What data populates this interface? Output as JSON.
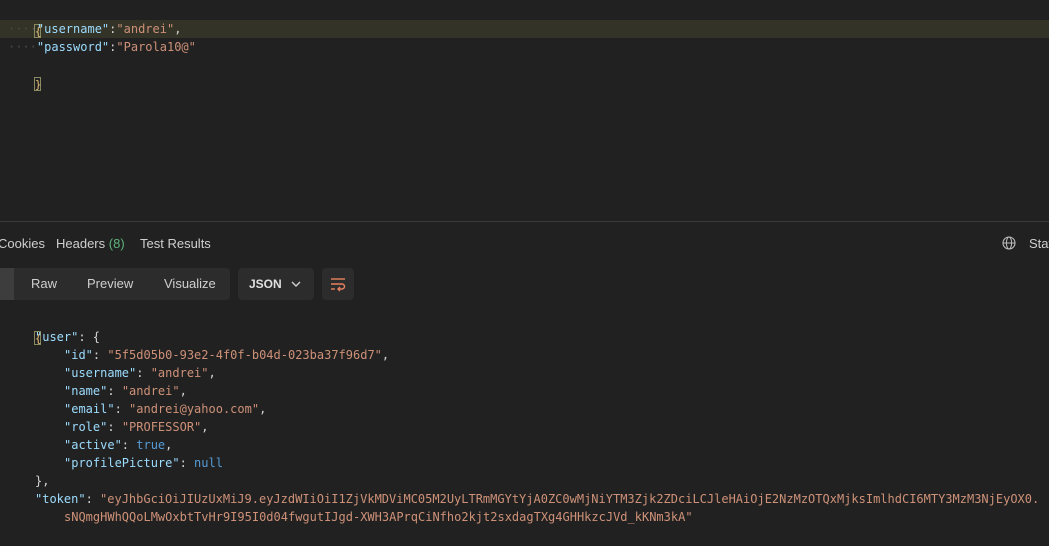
{
  "request_body": {
    "lines": [
      {
        "key": "\"username\"",
        "value": "\"andrei\"",
        "trail": ","
      },
      {
        "key": "\"password\"",
        "value": "\"Parola10@\"",
        "trail": ""
      }
    ],
    "open_brace": "{",
    "close_brace": "}"
  },
  "tabs": {
    "cookies": "Cookies",
    "headers": "Headers",
    "headers_count": "(8)",
    "test_results": "Test Results",
    "status_partial": "Stat"
  },
  "toolbar": {
    "raw": "Raw",
    "preview": "Preview",
    "visualize": "Visualize",
    "format": "JSON"
  },
  "response": {
    "open_brace": "{",
    "user_key": "\"user\"",
    "user_open": ": {",
    "fields": [
      {
        "key": "\"id\"",
        "value": "\"5f5d05b0-93e2-4f0f-b04d-023ba37f96d7\"",
        "kind": "str",
        "trail": ","
      },
      {
        "key": "\"username\"",
        "value": "\"andrei\"",
        "kind": "str",
        "trail": ","
      },
      {
        "key": "\"name\"",
        "value": "\"andrei\"",
        "kind": "str",
        "trail": ","
      },
      {
        "key": "\"email\"",
        "value": "\"andrei@yahoo.com\"",
        "kind": "str",
        "trail": ","
      },
      {
        "key": "\"role\"",
        "value": "\"PROFESSOR\"",
        "kind": "str",
        "trail": ","
      },
      {
        "key": "\"active\"",
        "value": "true",
        "kind": "kw",
        "trail": ","
      },
      {
        "key": "\"profilePicture\"",
        "value": "null",
        "kind": "kw",
        "trail": ""
      }
    ],
    "user_close": "},",
    "token_key": "\"token\"",
    "token_line1": "\"eyJhbGciOiJIUzUxMiJ9.eyJzdWIiOiI1ZjVkMDViMC05M2UyLTRmMGYtYjA0ZC0wMjNiYTM3Zjk2ZDciLCJleHAiOjE2NzMzOTQxMjksImlhdCI6MTY3MzM3NjEyOX0.",
    "token_line2": "sNQmgHWhQQoLMwOxbtTvHr9I95I0d04fwgutIJgd-XWH3APrqCiNfho2kjt2sxdagTXg4GHHkzcJVd_kKNm3kA\""
  },
  "icons": [
    "globe-icon",
    "chevron-down-icon",
    "wrap-lines-icon"
  ],
  "colors": {
    "background": "#212121",
    "key": "#9cdcfe",
    "string": "#ce9178",
    "keyword": "#569cd6",
    "count": "#5fb27a"
  }
}
